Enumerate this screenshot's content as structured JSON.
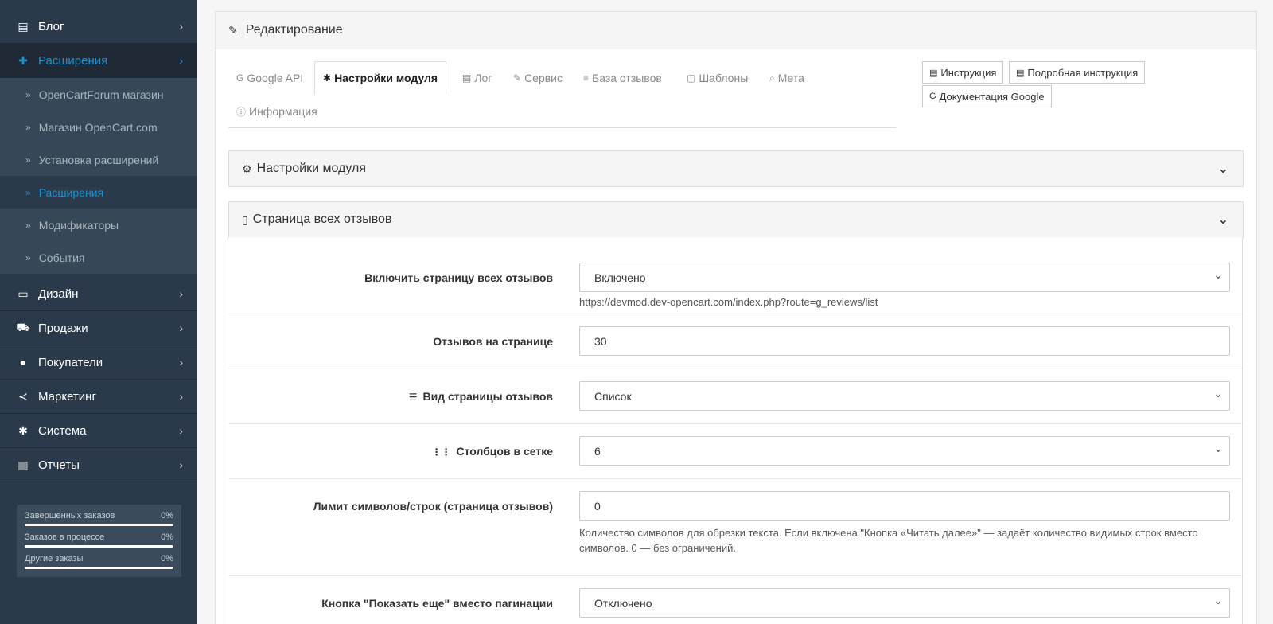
{
  "sidebar": {
    "items": [
      {
        "icon": "book-icon",
        "glyph": "▤",
        "label": "Блог"
      },
      {
        "icon": "puzzle-icon",
        "glyph": "✚",
        "label": "Расширения"
      }
    ],
    "sub_items": [
      "OpenCartForum магазин",
      "Магазин OpenCart.com",
      "Установка расширений",
      "Расширения",
      "Модификаторы",
      "События"
    ],
    "items_after": [
      {
        "icon": "monitor-icon",
        "glyph": "▭",
        "label": "Дизайн"
      },
      {
        "icon": "cart-icon",
        "glyph": "⛟",
        "label": "Продажи"
      },
      {
        "icon": "user-icon",
        "glyph": "●",
        "label": "Покупатели"
      },
      {
        "icon": "share-icon",
        "glyph": "≺",
        "label": "Маркетинг"
      },
      {
        "icon": "gear-icon",
        "glyph": "✱",
        "label": "Система"
      },
      {
        "icon": "bar-chart-icon",
        "glyph": "▥",
        "label": "Отчеты"
      }
    ],
    "stats": [
      {
        "label": "Завершенных заказов",
        "value": "0%"
      },
      {
        "label": "Заказов в процессе",
        "value": "0%"
      },
      {
        "label": "Другие заказы",
        "value": "0%"
      }
    ]
  },
  "panel": {
    "title": "Редактирование",
    "tabs": [
      {
        "label": "Google API",
        "glyph": "G"
      },
      {
        "label": "Настройки модуля",
        "glyph": "✱"
      },
      {
        "label": "Лог",
        "glyph": "▤"
      },
      {
        "label": "Сервис",
        "glyph": "✎"
      },
      {
        "label": "База отзывов",
        "glyph": "≡"
      },
      {
        "label": "Шаблоны",
        "glyph": "▢"
      },
      {
        "label": "Мета",
        "glyph": "⌕"
      },
      {
        "label": "Информация",
        "glyph": "ⓘ"
      }
    ],
    "help_buttons": [
      {
        "label": "Инструкция",
        "glyph": "▤"
      },
      {
        "label": "Подробная инструкция",
        "glyph": "▤"
      },
      {
        "label": "Документация Google",
        "glyph": "G"
      }
    ],
    "sections": [
      {
        "title": "Настройки модуля",
        "glyph": "⚙"
      },
      {
        "title": "Страница всех отзывов",
        "glyph": "▯"
      }
    ],
    "form": {
      "enable_page": {
        "label": "Включить страницу всех отзывов",
        "value": "Включено",
        "help": "https://devmod.dev-opencart.com/index.php?route=g_reviews/list"
      },
      "per_page": {
        "label": "Отзывов на странице",
        "value": "30"
      },
      "view": {
        "label": "Вид страницы отзывов",
        "value": "Список",
        "glyph": "☰"
      },
      "columns": {
        "label": "Столбцов в сетке",
        "value": "6",
        "glyph": "⋮⋮"
      },
      "limit": {
        "label": "Лимит символов/строк (страница отзывов)",
        "value": "0",
        "help": "Количество символов для обрезки текста. Если включена \"Кнопка «Читать далее»\" — задаёт количество видимых строк вместо символов. 0 — без ограничений."
      },
      "show_more": {
        "label": "Кнопка \"Показать еще\" вместо пагинации",
        "value": "Отключено"
      }
    }
  }
}
